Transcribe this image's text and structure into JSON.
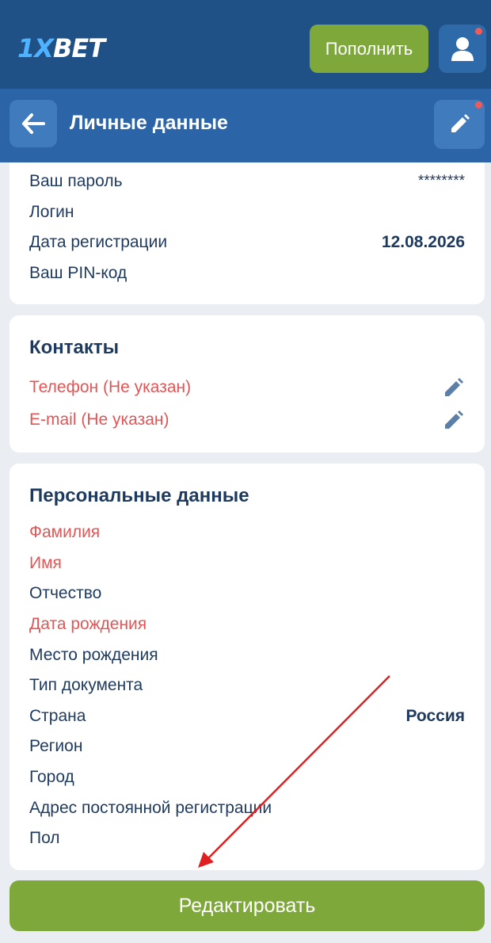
{
  "header": {
    "logo_prefix": "1X",
    "logo_suffix": "BET",
    "deposit_label": "Пополнить"
  },
  "subheader": {
    "title": "Личные данные"
  },
  "account": {
    "rows": [
      {
        "label": "Ваш пароль",
        "value": "********"
      },
      {
        "label": "Логин",
        "value": ""
      },
      {
        "label": "Дата регистрации",
        "value": "12.08.2026"
      },
      {
        "label": "Ваш PIN-код",
        "value": ""
      }
    ]
  },
  "contacts": {
    "title": "Контакты",
    "rows": [
      {
        "label": "Телефон (Не указан)"
      },
      {
        "label": "E-mail (Не указан)"
      }
    ]
  },
  "personal": {
    "title": "Персональные данные",
    "rows": [
      {
        "label": "Фамилия",
        "value": ""
      },
      {
        "label": "Имя",
        "value": ""
      },
      {
        "label": "Отчество",
        "value": ""
      },
      {
        "label": "Дата рождения",
        "value": ""
      },
      {
        "label": "Место рождения",
        "value": ""
      },
      {
        "label": "Тип документа",
        "value": ""
      },
      {
        "label": "Страна",
        "value": "Россия"
      },
      {
        "label": "Регион",
        "value": ""
      },
      {
        "label": "Город",
        "value": ""
      },
      {
        "label": "Адрес постоянной регистрации",
        "value": ""
      },
      {
        "label": "Пол",
        "value": ""
      }
    ]
  },
  "footer": {
    "edit_label": "Редактировать"
  },
  "colors": {
    "header_bg": "#1f5086",
    "subheader_bg": "#2b65a7",
    "accent_green": "#7ea93a",
    "required_red": "#e15656",
    "annotation_arrow": "#e02020"
  },
  "icons": {
    "back": "arrow-left-icon",
    "edit": "pencil-icon",
    "user": "user-icon",
    "notification": "notification-dot-icon"
  }
}
